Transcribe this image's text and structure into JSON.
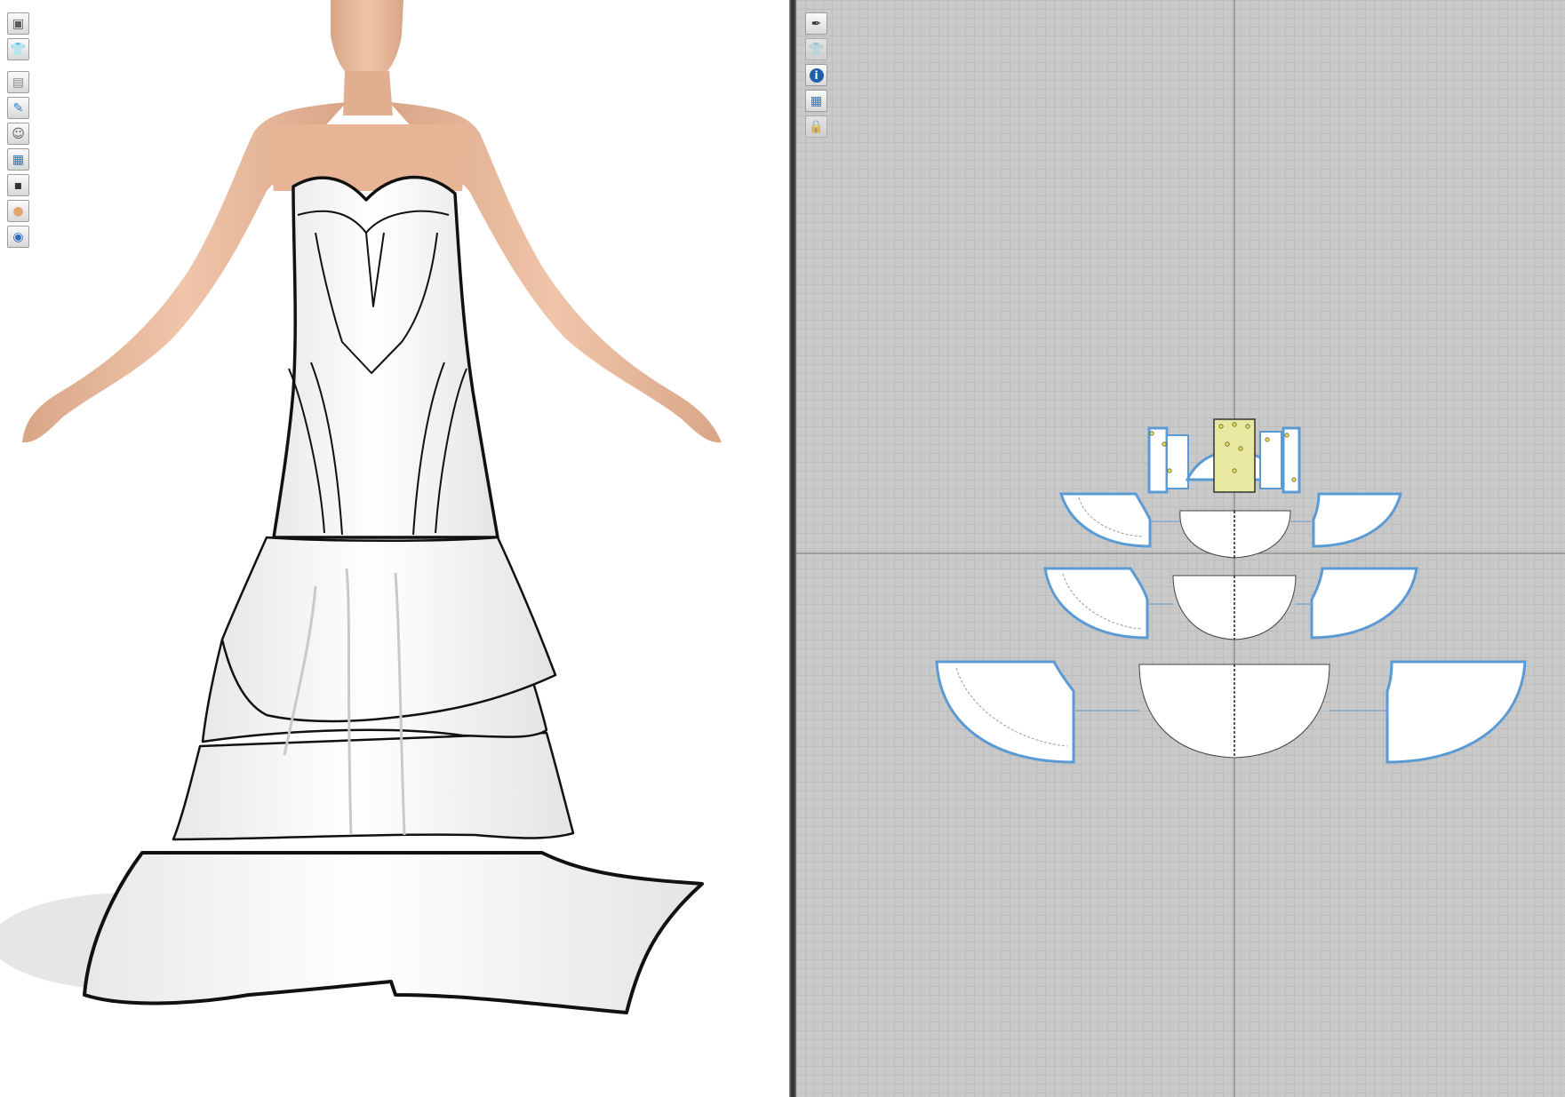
{
  "app": {
    "viewports": [
      "3d-view",
      "2d-pattern-view"
    ]
  },
  "tools3d": [
    {
      "icon": "avatar-display-icon",
      "glyph": "▣",
      "color": "#5a5a5a"
    },
    {
      "icon": "garment-display-icon",
      "glyph": "👕",
      "color": "#333333"
    },
    {
      "icon": "garment-shading-icon",
      "glyph": "▤",
      "color": "#8a8a8a"
    },
    {
      "icon": "texture-brush-icon",
      "glyph": "✎",
      "color": "#2b7fd1"
    },
    {
      "icon": "avatar-silhouette-icon",
      "glyph": "☺",
      "color": "#555555"
    },
    {
      "icon": "fabric-texture-icon",
      "glyph": "▦",
      "color": "#1f78d6"
    },
    {
      "icon": "monitor-icon",
      "glyph": "▪",
      "color": "#333333"
    },
    {
      "icon": "avatar-skin-icon",
      "glyph": "●",
      "color": "#e3a36c"
    },
    {
      "icon": "globe-icon",
      "glyph": "◉",
      "color": "#2d6fc2"
    }
  ],
  "tools2d": [
    {
      "icon": "edit-pen-icon",
      "glyph": "✒",
      "color": "#333333"
    },
    {
      "icon": "show-garment-icon",
      "glyph": "👕",
      "color": "#777777"
    },
    {
      "icon": "info-icon",
      "glyph": "i",
      "color": "#1f5fa8"
    },
    {
      "icon": "texture-display-icon",
      "glyph": "▦",
      "color": "#1f78d6"
    },
    {
      "icon": "lock-garment-icon",
      "glyph": "🔒",
      "color": "#888888"
    }
  ],
  "colors": {
    "background_3d": "#ffffff",
    "grid_background": "#c9c9c9",
    "pattern_fill": "#ffffff",
    "pattern_outline_selected": "#5b9bd5",
    "seam_point": "#e5e04a",
    "axis_line": "#8f8f8f",
    "skin": "#e6b79a"
  }
}
